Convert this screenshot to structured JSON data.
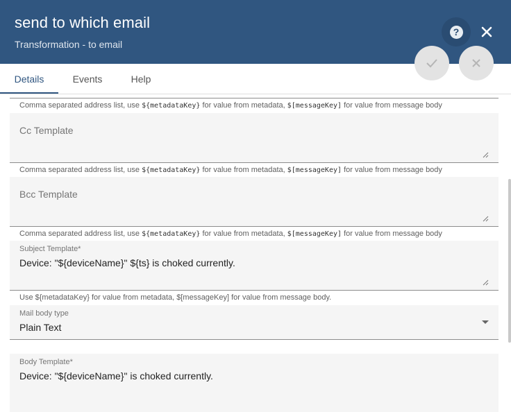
{
  "header": {
    "title": "send to which email",
    "subtitle": "Transformation - to email",
    "help_icon": "?",
    "close_icon": "close-icon"
  },
  "actions": {
    "apply_icon": "check-icon",
    "cancel_icon": "close-icon"
  },
  "tabs": [
    {
      "label": "Details",
      "active": true
    },
    {
      "label": "Events",
      "active": false
    },
    {
      "label": "Help",
      "active": false
    }
  ],
  "address_hint": {
    "pre": "Comma separated address list, use ",
    "metadata_code": "${metadataKey}",
    "mid": " for value from metadata, ",
    "message_code": "$[messageKey]",
    "post": " for value from message body"
  },
  "fields": {
    "cc": {
      "label": "Cc Template",
      "value": ""
    },
    "bcc": {
      "label": "Bcc Template",
      "value": ""
    },
    "subject": {
      "label": "Subject Template*",
      "value": "Device: \"${deviceName}\" ${ts} is choked currently.",
      "hint": "Use ${metadataKey} for value from metadata, $[messageKey] for value from message body."
    },
    "mail_body_type": {
      "label": "Mail body type",
      "value": "Plain Text"
    },
    "body": {
      "label": "Body Template*",
      "value": "Device: \"${deviceName}\" is choked currently."
    }
  },
  "colors": {
    "header": "#305680",
    "field_bg": "#f5f5f5"
  }
}
